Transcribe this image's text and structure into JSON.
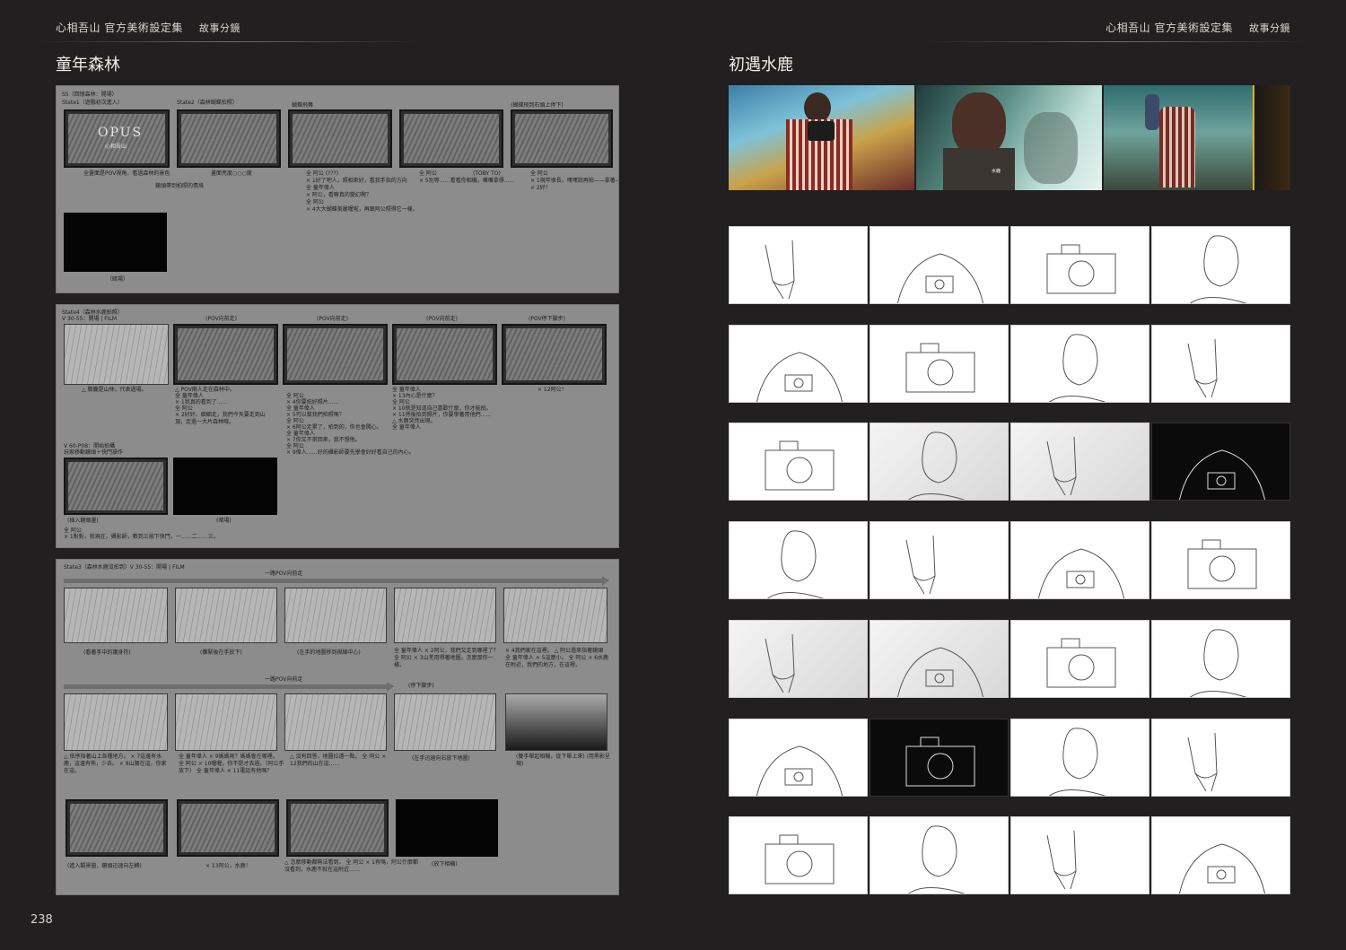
{
  "header": {
    "book_title": "心相吾山 官方美術設定集",
    "section": "故事分鏡"
  },
  "left_page": {
    "title": "童年森林",
    "page_number": "238",
    "sheets": [
      {
        "scene_label": "S5（回憶森林：開場）",
        "state1_label": "State1（遊戲初次進入）",
        "state2_label": "State2（森林蝴蝶拍照）",
        "logo_text": "OPUS",
        "logo_sub": "心相吾山",
        "notes": [
          "全畫面是POV視角，看過森林的景色",
          "蝴蝶飛舞",
          "畫面亮度○○○度",
          "鏡頭帶到拍照的情境",
          "(蝴蝶飛到石頭上停下)",
          "全 阿公 (???)",
          "× 1好了吧人，照相來好，看我手指的方向",
          "全 童年偉人",
          "× 阿公，看嘛真的變幻啊？",
          "全 阿公",
          "× 4大大蝴蝶美麗喔啦，再跟阿公照得它一樣。",
          "全 阿公",
          "× 5別等……看看你相機，嘴嘴拿得……",
          "(TOBY TO)",
          "全 阿公",
          "× 1現年很長，嘿嘿說再拍——拿著——",
          "× 2好！",
          "（暗場）"
        ]
      },
      {
        "state_label": "State4（森林水鹿拍照）",
        "shot_label": "V 30-55：開場 | FILM",
        "pov_labels": [
          "(POV向前走)",
          "(POV向前走)",
          "(POV向前走)",
          "(POV停下腳步)"
        ],
        "captions": [
          "△ 朦朧是山林，代表過場。",
          "△ POV兩人走在森林中。",
          "全 童年偉人",
          "× 1我真的看到了……",
          "全 阿公",
          "× 2好好，細細走，我們今天要走到山頂，走過一大片森林哦。",
          "全 阿公",
          "× 4你要拍好照片……",
          "全 童年偉人",
          "× 5可以幫我們拍照嗎？",
          "全 阿公",
          "× 6阿公走累了，拍到的，你也會開心。",
          "全 童年偉人",
          "× 7你又不來回來，我不想他。",
          "全 阿公",
          "× 9偉人……好的攝影師要先學會好好看自己的內心。",
          "全 童年偉人",
          "× 13內心是什麼？",
          "全 阿公",
          "× 10就是知道自己喜歡什麼，你才能拍。",
          "× 11然後拍到照片，你要學著用他們……",
          "△ 水鹿突然出現。",
          "全 童年偉人",
          "× 12阿公！"
        ],
        "shot2_label": "V 60-P08：開始拍攝",
        "shot2_sub": "玩家移動鏡頭＋快門操作",
        "caption_insert": "(插入鏡頭畫)",
        "caption_black": "(暗場)",
        "end_notes": [
          "全 阿公",
          "× 1對對，就現在，攝影師，數到三按下快門，一……二……三。"
        ]
      },
      {
        "state_label": "State3（森林水鹿沒拍到）V 30-55：開場 | FILM",
        "walk_label_1": "一路POV向前走",
        "walk_label_2": "一路POV向前走",
        "stop_label": "(停下腳步)",
        "captions_row1": [
          "(看著手中的護身符)",
          "(攤緊後在手放下)",
          "(左手的地圖移到視線中心)",
          "全 童年偉人 × 2阿公，我們又走到哪裡了？ 全 阿公 × 3山羌用得著地圖，怎麼那你一樣。",
          "× 4我們家在這裡。 △ 阿公過來指著鏡頭 全 童年偉人 × 5這麼小。 全 阿公 × 6水鹿在附近，我們的地方，在這裡。"
        ],
        "captions_row2": [
          "△ 依序指著山上各種地方。 × 7這邊有水鹿，這邊有熊，少去。 × 8山腰在這，你家在這。",
          "全 童年偉人 × 9媽媽呢？媽媽會在哪裡。 全 阿公 × 10喔喔，你不是才去過。（阿公手放下） 全 童年偉人 × 11電話有他嗎？",
          "△ 沒有回答，地圖拉遠一點。 全 阿公 × 12我們的山在這……",
          "(左手迅速向右放下地圖)",
          "(雙手舉起相機，從下舉上來) (用黑影呈現)"
        ],
        "captions_row3": [
          "(進入觀景窗，鏡頭迅速向左轉)",
          "× 13阿公，水鹿！",
          "△ 怎麼移動都無法看到。 全 阿公 × 1有嗎，阿公什麼都沒看到，水鹿不就在這附近……",
          "(放下相機)"
        ]
      }
    ]
  },
  "right_page": {
    "title": "初遇水鹿",
    "stills": [
      {
        "desc": "character-with-camera"
      },
      {
        "desc": "character-and-deer",
        "subtitle": "水鹿"
      },
      {
        "desc": "child-and-grandfather"
      }
    ],
    "panel_tones": [
      [
        "light",
        "light",
        "light",
        "light"
      ],
      [
        "light",
        "light",
        "light",
        "light"
      ],
      [
        "light",
        "grey",
        "grey",
        "dark"
      ],
      [
        "light",
        "light",
        "light",
        "light"
      ],
      [
        "grey",
        "grey",
        "light",
        "light"
      ],
      [
        "light",
        "dark",
        "light",
        "light"
      ],
      [
        "light",
        "light",
        "light",
        "light"
      ]
    ]
  }
}
